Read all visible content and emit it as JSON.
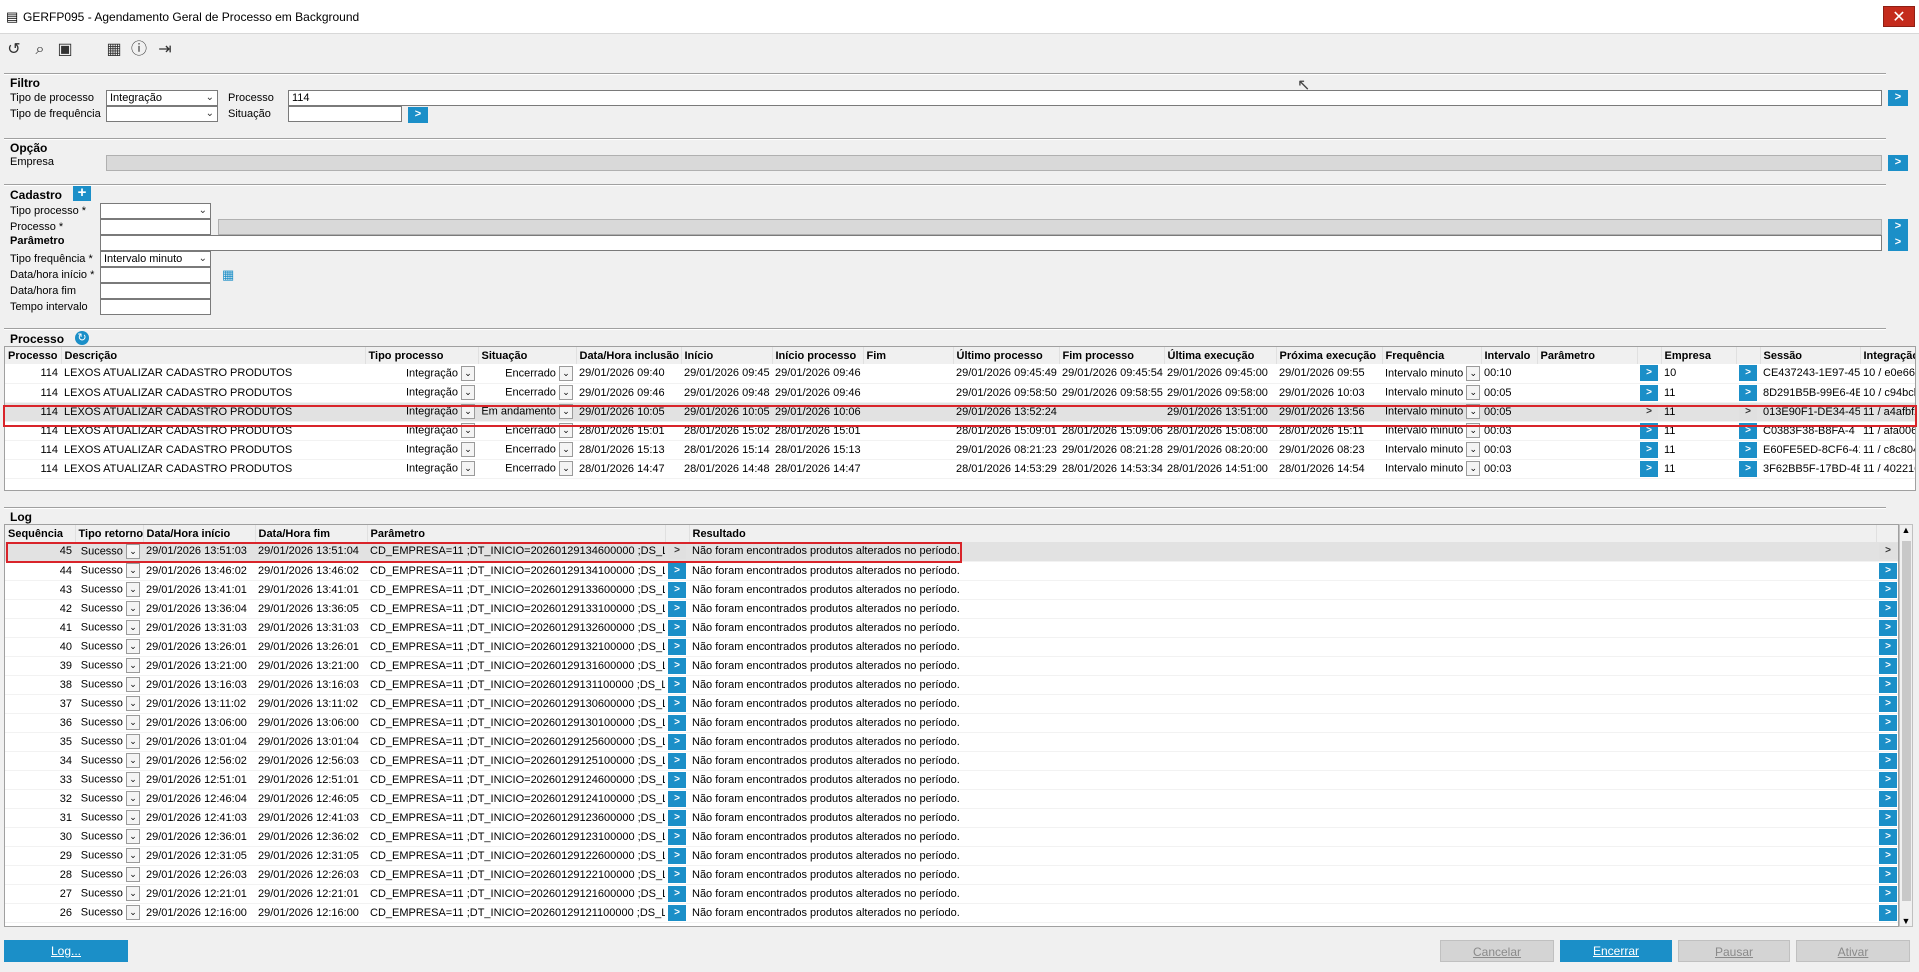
{
  "window": {
    "title": "GERFP095 - Agendamento Geral de Processo em Background",
    "close_glyph": "✕"
  },
  "toolbar_icons": [
    "undo-icon",
    "search-icon",
    "save-icon",
    "calendar-icon",
    "help-icon",
    "exit-icon"
  ],
  "filtro": {
    "header": "Filtro",
    "tipo_processo_label": "Tipo de processo",
    "tipo_processo_value": "Integração",
    "processo_label": "Processo",
    "processo_value": "114",
    "tipo_frequencia_label": "Tipo de frequência",
    "tipo_frequencia_value": "",
    "situacao_label": "Situação",
    "situacao_value": ""
  },
  "opcao": {
    "header": "Opção",
    "empresa_label": "Empresa",
    "empresa_value": ""
  },
  "cadastro": {
    "header": "Cadastro",
    "tipo_processo_label": "Tipo processo *",
    "processo_label": "Processo *",
    "parametro_header": "Parâmetro",
    "tipo_frequencia_label": "Tipo frequência *",
    "tipo_frequencia_value": "Intervalo minuto",
    "data_inicio_label": "Data/hora início *",
    "data_fim_label": "Data/hora fim",
    "tempo_intervalo_label": "Tempo intervalo"
  },
  "processo_grid": {
    "header": "Processo",
    "columns": [
      "Processo",
      "Descrição",
      "Tipo processo",
      "Situação",
      "Data/Hora inclusão",
      "Início",
      "Início processo",
      "Fim",
      "Último processo",
      "Fim processo",
      "Última execução",
      "Próxima execução",
      "Frequência",
      "Intervalo",
      "Parâmetro",
      "",
      "Empresa",
      "",
      "Sessão",
      "Integração"
    ],
    "rows": [
      [
        "114",
        "LEXOS ATUALIZAR CADASTRO PRODUTOS",
        "Integração",
        "Encerrado",
        "29/01/2026 09:40",
        "29/01/2026 09:45",
        "29/01/2026 09:46",
        "",
        "29/01/2026 09:45:49",
        "29/01/2026 09:45:54",
        "29/01/2026 09:45:00",
        "29/01/2026 09:55",
        "Intervalo minuto",
        "00:10",
        "",
        "10",
        "CE437243-1E97-45",
        "10 / e0e668"
      ],
      [
        "114",
        "LEXOS ATUALIZAR CADASTRO PRODUTOS",
        "Integração",
        "Encerrado",
        "29/01/2026 09:46",
        "29/01/2026 09:48",
        "29/01/2026 09:46",
        "",
        "29/01/2026 09:58:50",
        "29/01/2026 09:58:55",
        "29/01/2026 09:58:00",
        "29/01/2026 10:03",
        "Intervalo minuto",
        "00:05",
        "",
        "11",
        "8D291B5B-99E6-4E",
        "10 / c94bcl"
      ],
      [
        "114",
        "LEXOS ATUALIZAR CADASTRO PRODUTOS",
        "Integração",
        "Em andamento",
        "29/01/2026 10:05",
        "29/01/2026 10:05",
        "29/01/2026 10:06",
        "",
        "29/01/2026 13:52:24",
        "",
        "29/01/2026 13:51:00",
        "29/01/2026 13:56",
        "Intervalo minuto",
        "00:05",
        "",
        "11",
        "013E90F1-DE34-45",
        "11 / a4afbf2"
      ],
      [
        "114",
        "LEXOS ATUALIZAR CADASTRO PRODUTOS",
        "Integração",
        "Encerrado",
        "28/01/2026 15:01",
        "28/01/2026 15:02",
        "28/01/2026 15:01",
        "",
        "28/01/2026 15:09:01",
        "28/01/2026 15:09:06",
        "28/01/2026 15:08:00",
        "28/01/2026 15:11",
        "Intervalo minuto",
        "00:03",
        "",
        "11",
        "C0383F38-B8FA-4",
        "11 / afa0063"
      ],
      [
        "114",
        "LEXOS ATUALIZAR CADASTRO PRODUTOS",
        "Integração",
        "Encerrado",
        "28/01/2026 15:13",
        "28/01/2026 15:14",
        "28/01/2026 15:13",
        "",
        "29/01/2026 08:21:23",
        "29/01/2026 08:21:28",
        "29/01/2026 08:20:00",
        "29/01/2026 08:23",
        "Intervalo minuto",
        "00:03",
        "",
        "11",
        "E60FE5ED-8CF6-41",
        "11 / c8c804"
      ],
      [
        "114",
        "LEXOS ATUALIZAR CADASTRO PRODUTOS",
        "Integração",
        "Encerrado",
        "28/01/2026 14:47",
        "28/01/2026 14:48",
        "28/01/2026 14:47",
        "",
        "28/01/2026 14:53:29",
        "28/01/2026 14:53:34",
        "28/01/2026 14:51:00",
        "28/01/2026 14:54",
        "Intervalo minuto",
        "00:03",
        "",
        "11",
        "3F62BB5F-17BD-4E",
        "11 / 402216"
      ]
    ]
  },
  "log_grid": {
    "header": "Log",
    "columns": [
      "Sequência",
      "Tipo retorno",
      "Data/Hora início",
      "Data/Hora fim",
      "Parâmetro",
      "",
      "Resultado"
    ],
    "rows": [
      [
        "45",
        "Sucesso",
        "29/01/2026 13:51:03",
        "29/01/2026 13:51:04",
        "CD_EMPRESA=11 ;DT_INICIO=20260129134600000 ;DS_L",
        "Não foram encontrados produtos alterados no período."
      ],
      [
        "44",
        "Sucesso",
        "29/01/2026 13:46:02",
        "29/01/2026 13:46:02",
        "CD_EMPRESA=11 ;DT_INICIO=20260129134100000 ;DS_L",
        "Não foram encontrados produtos alterados no período."
      ],
      [
        "43",
        "Sucesso",
        "29/01/2026 13:41:01",
        "29/01/2026 13:41:01",
        "CD_EMPRESA=11 ;DT_INICIO=20260129133600000 ;DS_L",
        "Não foram encontrados produtos alterados no período."
      ],
      [
        "42",
        "Sucesso",
        "29/01/2026 13:36:04",
        "29/01/2026 13:36:05",
        "CD_EMPRESA=11 ;DT_INICIO=20260129133100000 ;DS_L",
        "Não foram encontrados produtos alterados no período."
      ],
      [
        "41",
        "Sucesso",
        "29/01/2026 13:31:03",
        "29/01/2026 13:31:03",
        "CD_EMPRESA=11 ;DT_INICIO=20260129132600000 ;DS_L",
        "Não foram encontrados produtos alterados no período."
      ],
      [
        "40",
        "Sucesso",
        "29/01/2026 13:26:01",
        "29/01/2026 13:26:01",
        "CD_EMPRESA=11 ;DT_INICIO=20260129132100000 ;DS_L",
        "Não foram encontrados produtos alterados no período."
      ],
      [
        "39",
        "Sucesso",
        "29/01/2026 13:21:00",
        "29/01/2026 13:21:00",
        "CD_EMPRESA=11 ;DT_INICIO=20260129131600000 ;DS_L",
        "Não foram encontrados produtos alterados no período."
      ],
      [
        "38",
        "Sucesso",
        "29/01/2026 13:16:03",
        "29/01/2026 13:16:03",
        "CD_EMPRESA=11 ;DT_INICIO=20260129131100000 ;DS_L",
        "Não foram encontrados produtos alterados no período."
      ],
      [
        "37",
        "Sucesso",
        "29/01/2026 13:11:02",
        "29/01/2026 13:11:02",
        "CD_EMPRESA=11 ;DT_INICIO=20260129130600000 ;DS_L",
        "Não foram encontrados produtos alterados no período."
      ],
      [
        "36",
        "Sucesso",
        "29/01/2026 13:06:00",
        "29/01/2026 13:06:00",
        "CD_EMPRESA=11 ;DT_INICIO=20260129130100000 ;DS_L",
        "Não foram encontrados produtos alterados no período."
      ],
      [
        "35",
        "Sucesso",
        "29/01/2026 13:01:04",
        "29/01/2026 13:01:04",
        "CD_EMPRESA=11 ;DT_INICIO=20260129125600000 ;DS_L",
        "Não foram encontrados produtos alterados no período."
      ],
      [
        "34",
        "Sucesso",
        "29/01/2026 12:56:02",
        "29/01/2026 12:56:03",
        "CD_EMPRESA=11 ;DT_INICIO=20260129125100000 ;DS_L",
        "Não foram encontrados produtos alterados no período."
      ],
      [
        "33",
        "Sucesso",
        "29/01/2026 12:51:01",
        "29/01/2026 12:51:01",
        "CD_EMPRESA=11 ;DT_INICIO=20260129124600000 ;DS_L",
        "Não foram encontrados produtos alterados no período."
      ],
      [
        "32",
        "Sucesso",
        "29/01/2026 12:46:04",
        "29/01/2026 12:46:05",
        "CD_EMPRESA=11 ;DT_INICIO=20260129124100000 ;DS_L",
        "Não foram encontrados produtos alterados no período."
      ],
      [
        "31",
        "Sucesso",
        "29/01/2026 12:41:03",
        "29/01/2026 12:41:03",
        "CD_EMPRESA=11 ;DT_INICIO=20260129123600000 ;DS_L",
        "Não foram encontrados produtos alterados no período."
      ],
      [
        "30",
        "Sucesso",
        "29/01/2026 12:36:01",
        "29/01/2026 12:36:02",
        "CD_EMPRESA=11 ;DT_INICIO=20260129123100000 ;DS_L",
        "Não foram encontrados produtos alterados no período."
      ],
      [
        "29",
        "Sucesso",
        "29/01/2026 12:31:05",
        "29/01/2026 12:31:05",
        "CD_EMPRESA=11 ;DT_INICIO=20260129122600000 ;DS_L",
        "Não foram encontrados produtos alterados no período."
      ],
      [
        "28",
        "Sucesso",
        "29/01/2026 12:26:03",
        "29/01/2026 12:26:03",
        "CD_EMPRESA=11 ;DT_INICIO=20260129122100000 ;DS_L",
        "Não foram encontrados produtos alterados no período."
      ],
      [
        "27",
        "Sucesso",
        "29/01/2026 12:21:01",
        "29/01/2026 12:21:01",
        "CD_EMPRESA=11 ;DT_INICIO=20260129121600000 ;DS_L",
        "Não foram encontrados produtos alterados no período."
      ],
      [
        "26",
        "Sucesso",
        "29/01/2026 12:16:00",
        "29/01/2026 12:16:00",
        "CD_EMPRESA=11 ;DT_INICIO=20260129121100000 ;DS_L",
        "Não foram encontrados produtos alterados no período."
      ]
    ]
  },
  "buttons": {
    "log": "Log...",
    "cancelar": "Cancelar",
    "encerrar": "Encerrar",
    "pausar": "Pausar",
    "ativar": "Ativar"
  },
  "colors": {
    "accent": "#1b8fc8",
    "highlight": "#d9242a",
    "close": "#c42b1c"
  }
}
